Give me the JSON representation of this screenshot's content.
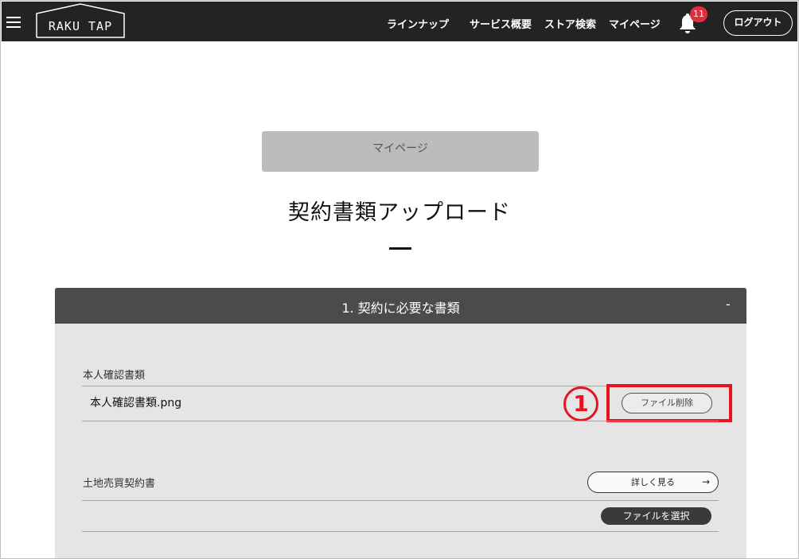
{
  "header": {
    "logo_text": "RAKU TAP",
    "nav": [
      {
        "label": "ラインナップ"
      },
      {
        "label": "サービス概要"
      },
      {
        "label": "ストア検索"
      },
      {
        "label": "マイページ"
      }
    ],
    "notification_count": "11",
    "logout_label": "ログアウト"
  },
  "main": {
    "mypage_button": "マイページ",
    "page_title": "契約書類アップロード",
    "panel": {
      "title": "1.  契約に必要な書類",
      "toggle": "-",
      "sections": [
        {
          "label": "本人確認書類",
          "file_name": "本人確認書類.png",
          "delete_label": "ファイル削除",
          "callout": "1"
        },
        {
          "label": "土地売買契約書",
          "detail_label": "詳しく見る",
          "detail_arrow": "→",
          "select_label": "ファイルを選択"
        }
      ]
    }
  },
  "colors": {
    "header_bg": "#232323",
    "panel_head_bg": "#4b4b4b",
    "panel_bg": "#e5e5e5",
    "badge": "#e52d3d",
    "callout": "#e5141e"
  },
  "icons": {
    "menu": "hamburger-menu-icon",
    "bell": "bell-icon",
    "arrow": "arrow-right-icon"
  }
}
